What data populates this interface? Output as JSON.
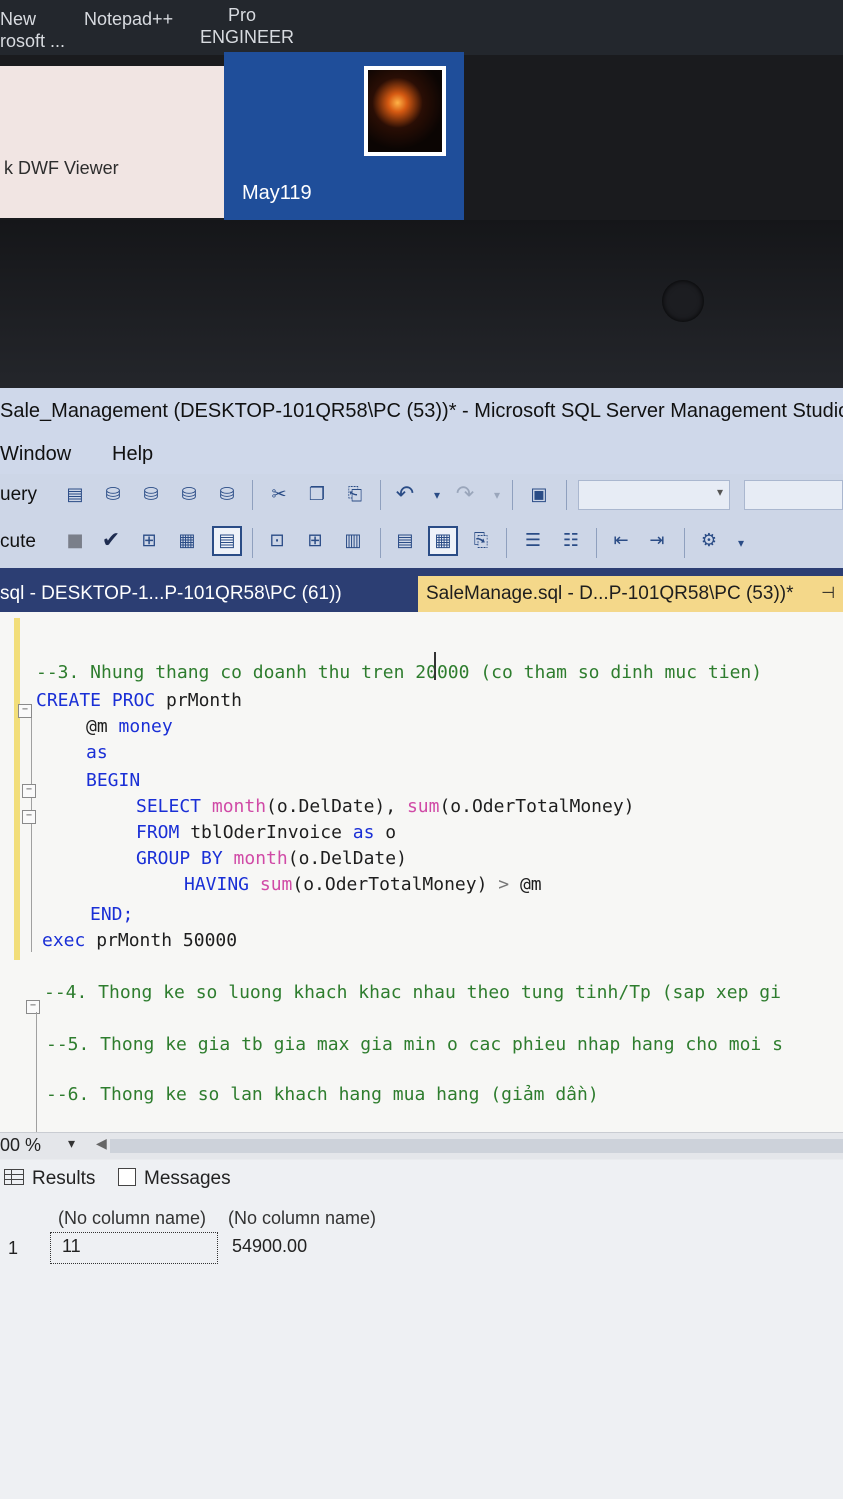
{
  "taskbar": {
    "items": [
      {
        "line1": "New",
        "line2": "rosoft ..."
      },
      {
        "line1": "Notepad++",
        "line2": ""
      },
      {
        "line1": "Pro",
        "line2": "ENGINEER"
      }
    ],
    "tile_dwf": "k DWF Viewer",
    "tile_may": "May119"
  },
  "window": {
    "title": "Sale_Management (DESKTOP-101QR58\\PC (53))* - Microsoft SQL Server Management Studio",
    "menu": [
      "Window",
      "Help"
    ],
    "toolbar1_lead": "uery",
    "toolbar2_lead": "cute"
  },
  "tabs": {
    "inactive": "sql - DESKTOP-1...P-101QR58\\PC (61))",
    "active": "SaleManage.sql - D...P-101QR58\\PC (53))*",
    "pin": "⊣"
  },
  "code": {
    "line1": "--3. Nhung thang co doanh thu tren 20000 (co tham so dinh muc tien)",
    "line2_kw": "CREATE PROC",
    "line2_name": " prMonth",
    "line3_var": "@m",
    "line3_type": " money",
    "line4": "as",
    "line5": "BEGIN",
    "line6_kw": "SELECT ",
    "line6_fn1": "month",
    "line6_a": "(o.DelDate), ",
    "line6_fn2": "sum",
    "line6_b": "(o.OderTotalMoney)",
    "line7_kw": "FROM",
    "line7_a": " tblOderInvoice ",
    "line7_kw2": "as",
    "line7_b": " o",
    "line8_kw": "GROUP BY ",
    "line8_fn": "month",
    "line8_a": "(o.DelDate)",
    "line9_kw": "HAVING ",
    "line9_fn": "sum",
    "line9_a": "(o.OderTotalMoney) ",
    "line9_op": ">",
    "line9_var": " @m",
    "line10": "END;",
    "line11_kw": "exec",
    "line11_a": " prMonth 50000",
    "line12": "--4. Thong ke so luong khach khac nhau theo tung tinh/Tp (sap xep gi",
    "line13": "--5. Thong ke gia tb gia max gia min o cac phieu nhap hang cho moi s",
    "line14": "--6. Thong ke so lan khach hang mua hang (giảm dần)"
  },
  "zoom": {
    "value": "00 %"
  },
  "results": {
    "tab_results": "Results",
    "tab_messages": "Messages",
    "headers": [
      "(No column name)",
      "(No column name)"
    ],
    "rows": [
      {
        "num": "1",
        "c1": "11",
        "c2": "54900.00"
      }
    ]
  }
}
